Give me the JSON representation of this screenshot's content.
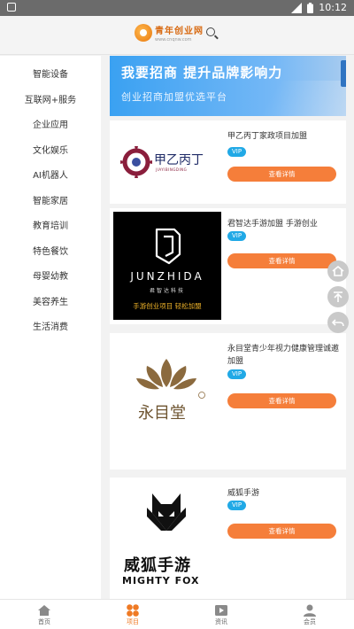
{
  "status": {
    "time": "10:12"
  },
  "header": {
    "logo_cn": "青年创业网",
    "logo_en": "www.cnqnw.com"
  },
  "sidebar": {
    "items": [
      {
        "label": "智能设备"
      },
      {
        "label": "互联网+服务"
      },
      {
        "label": "企业应用"
      },
      {
        "label": "文化娱乐"
      },
      {
        "label": "AI机器人"
      },
      {
        "label": "智能家居"
      },
      {
        "label": "教育培训"
      },
      {
        "label": "特色餐饮"
      },
      {
        "label": "母婴幼教"
      },
      {
        "label": "美容养生"
      },
      {
        "label": "生活消费"
      }
    ]
  },
  "banner": {
    "title": "我要招商  提升品牌影响力",
    "subtitle": "创业招商加盟优选平台"
  },
  "cards": [
    {
      "title": "甲乙丙丁家政项目加盟",
      "vip": "VIP",
      "button": "查看详情",
      "logo_cn": "甲乙丙丁",
      "logo_en": "JIAYIBINGDING"
    },
    {
      "title": "君智达手游加盟 手游创业",
      "vip": "VIP",
      "button": "查看详情",
      "logo_brand": "JUNZHIDA",
      "logo_sub": "君智达科技",
      "logo_slogan": "手游创业项目  轻松加盟"
    },
    {
      "title": "永目堂青少年视力健康管理诚邀加盟",
      "vip": "VIP",
      "button": "查看详情",
      "logo_cn": "永目堂"
    },
    {
      "title": "威狐手游",
      "vip": "VIP",
      "button": "查看详情",
      "logo_cn": "威狐手游",
      "logo_en": "MIGHTY FOX"
    }
  ],
  "side_tools": [
    {
      "icon": "home-icon"
    },
    {
      "icon": "back-to-top-icon"
    },
    {
      "icon": "back-icon"
    }
  ],
  "tabbar": {
    "tabs": [
      {
        "label": "首页",
        "icon": "home-icon"
      },
      {
        "label": "项目",
        "icon": "project-icon"
      },
      {
        "label": "资讯",
        "icon": "news-video-icon"
      },
      {
        "label": "会员",
        "icon": "member-icon"
      }
    ],
    "active_color": "#ef7a24"
  },
  "colors": {
    "accent": "#f57e3a",
    "vip": "#21a9e6",
    "banner": "#3aa1f2"
  }
}
